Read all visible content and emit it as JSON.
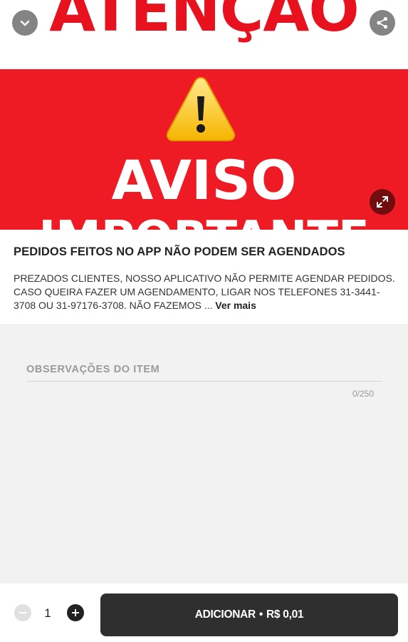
{
  "hero": {
    "top_text": "ATENÇÃO",
    "main_text": "AVISO",
    "sub_text": "IMPORTANTE"
  },
  "icons": {
    "collapse": "chevron-down-icon",
    "share": "share-icon",
    "expand": "expand-icon",
    "warning": "warning-icon",
    "minus": "minus-icon",
    "plus": "plus-icon"
  },
  "colors": {
    "brand_red": "#ee1b24",
    "button_dark": "#2f2f2f"
  },
  "item": {
    "title": "PEDIDOS FEITOS NO APP NÃO PODEM SER AGENDADOS",
    "description": "PREZADOS CLIENTES, NOSSO APLICATIVO NÃO PERMITE AGENDAR PEDIDOS. CASO QUEIRA FAZER UM AGENDAMENTO, LIGAR NOS TELEFONES 31-3441-3708 OU 31-97176-3708. NÃO FAZEMOS ...",
    "see_more": "Ver mais"
  },
  "observations": {
    "label": "OBSERVAÇÕES DO ITEM",
    "value": "",
    "counter": "0/250"
  },
  "cart": {
    "quantity": "1",
    "add_label": "ADICIONAR",
    "separator": "•",
    "price": "R$ 0,01"
  }
}
